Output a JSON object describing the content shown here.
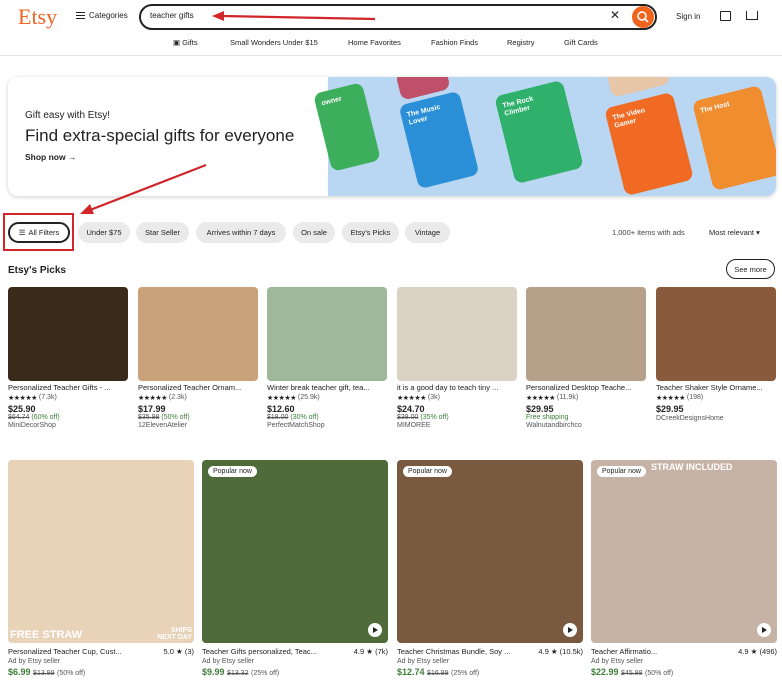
{
  "header": {
    "logo": "Etsy",
    "categories": "Categories",
    "search_value": "teacher gifts",
    "signin": "Sign in"
  },
  "subnav": [
    "Gifts",
    "Small Wonders Under $15",
    "Home Favorites",
    "Fashion Finds",
    "Registry",
    "Gift Cards"
  ],
  "banner": {
    "small": "Gift easy with Etsy!",
    "title": "Find extra-special gifts for everyone",
    "link": "Shop now",
    "tiles": [
      "The Music Lover",
      "The Rock Climber",
      "The Video Gamer",
      "The Host",
      "owner"
    ]
  },
  "filters": {
    "all": "All Filters",
    "chips": [
      "Under $75",
      "Star Seller",
      "Arrives within 7 days",
      "On sale",
      "Etsy's Picks",
      "Vintage"
    ],
    "count": "1,000+ items with ads",
    "sort": "Most relevant"
  },
  "picks": {
    "title": "Etsy's Picks",
    "see_more": "See more",
    "items": [
      {
        "title": "Personalized Teacher Gifts - ...",
        "reviews": "(7.3k)",
        "price": "$25.90",
        "orig": "$64.74",
        "off": "(60% off)",
        "shop": "MiniDecorShop",
        "color": "#3a2a1a"
      },
      {
        "title": "Personalized Teacher Ornam...",
        "reviews": "(2.3k)",
        "price": "$17.99",
        "orig": "$35.98",
        "off": "(50% off)",
        "shop": "12ElevenAtelier",
        "color": "#c9a27a"
      },
      {
        "title": "Winter break teacher gift, tea...",
        "reviews": "(25.9k)",
        "price": "$12.60",
        "orig": "$18.00",
        "off": "(30% off)",
        "shop": "PerfectMatchShop",
        "color": "#9fb89a"
      },
      {
        "title": "it is a good day to teach tiny ...",
        "reviews": "(3k)",
        "price": "$24.70",
        "orig": "$38.00",
        "off": "(35% off)",
        "shop": "MIMOREE",
        "color": "#d9d2c5"
      },
      {
        "title": "Personalized Desktop Teache...",
        "reviews": "(11.9k)",
        "price": "$29.95",
        "orig": "",
        "off": "Free shipping",
        "shop": "Walnutandbirchco",
        "color": "#b7a089"
      },
      {
        "title": "Teacher Shaker Style Orname...",
        "reviews": "(198)",
        "price": "$29.95",
        "orig": "",
        "off": "",
        "shop": "DCreekDesignsHome",
        "color": "#8a5a3c"
      }
    ]
  },
  "listings": [
    {
      "title": "Personalized Teacher Cup, Cust...",
      "rating": "5.0",
      "reviews": "(3)",
      "ad": "Ad by Etsy seller",
      "price": "$6.99",
      "orig": "$13.99",
      "off": "(50% off)",
      "popular": "",
      "overlay1": "FREE STRAW",
      "overlay2": "SHIPS NEXT DAY",
      "color": "#e8d2b8"
    },
    {
      "title": "Teacher Gifts personalized, Teac...",
      "rating": "4.9",
      "reviews": "(7k)",
      "ad": "Ad by Etsy seller",
      "price": "$9.99",
      "orig": "$13.32",
      "off": "(25% off)",
      "popular": "Popular now",
      "overlay1": "",
      "overlay2": "",
      "color": "#4f6b3a"
    },
    {
      "title": "Teacher Christmas Bundle, Soy ...",
      "rating": "4.9",
      "reviews": "(10.5k)",
      "ad": "Ad by Etsy seller",
      "price": "$12.74",
      "orig": "$16.99",
      "off": "(25% off)",
      "popular": "Popular now",
      "overlay1": "",
      "overlay2": "",
      "color": "#7a5a3e"
    },
    {
      "title": "Teacher Affirmatio...",
      "rating": "4.9",
      "reviews": "(496)",
      "ad": "Ad by Etsy seller",
      "price": "$22.99",
      "orig": "$45.98",
      "off": "(50% off)",
      "popular": "Popular now",
      "overlay1": "STRAW INCLUDED",
      "overlay2": "",
      "color": "#c7b3a6"
    }
  ],
  "colors": {
    "accent": "#f1641e",
    "annotation": "#d0262a",
    "sale": "#3e7e39"
  }
}
